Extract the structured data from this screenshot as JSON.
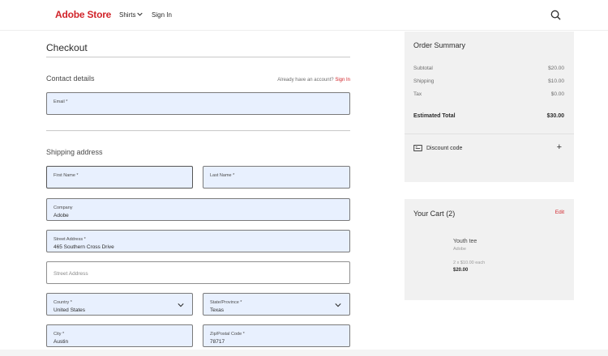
{
  "header": {
    "logo": "Adobe Store",
    "nav_shirts": "Shirts",
    "nav_signin": "Sign In"
  },
  "checkout": {
    "title": "Checkout",
    "contact_title": "Contact details",
    "already_text": "Already have an account?",
    "already_link": "Sign In",
    "email": {
      "label": "Email *",
      "value": ""
    },
    "shipping_title": "Shipping address",
    "first_name": {
      "label": "First Name *",
      "value": ""
    },
    "last_name": {
      "label": "Last Name *",
      "value": ""
    },
    "company": {
      "label": "Company",
      "value": "Adobe"
    },
    "street1": {
      "label": "Street Address *",
      "value": "465 Southern Cross Drive"
    },
    "street2": {
      "placeholder": "Street Address"
    },
    "country": {
      "label": "Country *",
      "value": "United States"
    },
    "state": {
      "label": "State/Province *",
      "value": "Texas"
    },
    "city": {
      "label": "City *",
      "value": "Austin"
    },
    "zip": {
      "label": "Zip/Postal Code *",
      "value": "78717"
    }
  },
  "summary": {
    "title": "Order Summary",
    "subtotal_label": "Subtotal",
    "subtotal_value": "$20.00",
    "shipping_label": "Shipping",
    "shipping_value": "$10.00",
    "tax_label": "Tax",
    "tax_value": "$0.00",
    "total_label": "Estimated Total",
    "total_value": "$30.00",
    "discount_label": "Discount code",
    "discount_toggle": "+"
  },
  "cart": {
    "title": "Your Cart (2)",
    "edit": "Edit",
    "item_name": "Youth tee",
    "item_brand": "Adobe",
    "item_qty": "2 x $10.00 each",
    "item_price": "$20.00"
  },
  "colors": {
    "brand": "#d1242a",
    "autofill": "#e8f0fe",
    "panel": "#f1f1f1"
  },
  "icons": {
    "search": "search-icon",
    "dropdown": "chevron-down-icon",
    "discount": "tag-icon"
  }
}
